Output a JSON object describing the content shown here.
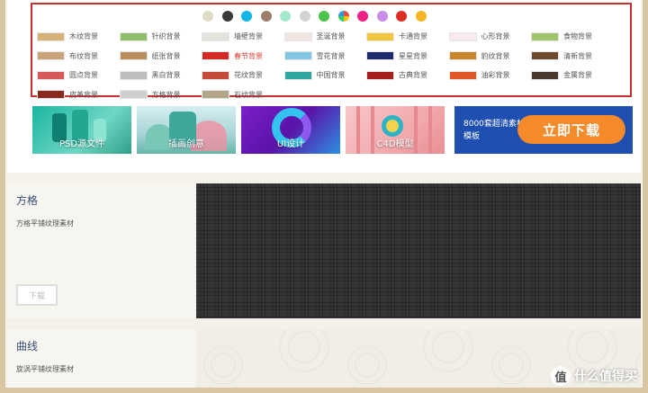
{
  "colors": {
    "swatches": [
      "#dedcc6",
      "#3a3a3a",
      "#12b6e6",
      "#9c7d6b",
      "#a4e8cc",
      "#d2d2d2",
      "#4cc34a",
      "multi",
      "#ec1f86",
      "#c98ce8",
      "#e02a25",
      "#f4b522"
    ],
    "accent": "#e2382f",
    "highlight_border": "#c8302f",
    "download_orange": "#f58a2a",
    "banner_blue": "#1f4fb0"
  },
  "categories": [
    {
      "label": "木纹背景",
      "thumb": "#d8b07a"
    },
    {
      "label": "针织背景",
      "thumb": "#8fbe6a"
    },
    {
      "label": "墙壁背景",
      "thumb": "#e4e2dc"
    },
    {
      "label": "圣诞背景",
      "thumb": "#f3e4e4"
    },
    {
      "label": "卡通背景",
      "thumb": "#f0c63a"
    },
    {
      "label": "心形背景",
      "thumb": "#f7e9ee"
    },
    {
      "label": "食物背景",
      "thumb": "#9fc46b"
    },
    {
      "label": "布纹背景",
      "thumb": "#c9a37b"
    },
    {
      "label": "纸张背景",
      "thumb": "#b98c5c"
    },
    {
      "label": "春节背景",
      "thumb": "#d42a24",
      "active": true
    },
    {
      "label": "雪花背景",
      "thumb": "#7fc7e2"
    },
    {
      "label": "星星背景",
      "thumb": "#1e2a6b"
    },
    {
      "label": "豹纹背景",
      "thumb": "#c8862d"
    },
    {
      "label": "清新背景",
      "thumb": "#6d4a2e"
    },
    {
      "label": "圆点背景",
      "thumb": "#d65a5a"
    },
    {
      "label": "黑白背景",
      "thumb": "#bdbdbd"
    },
    {
      "label": "花纹背景",
      "thumb": "#c44b3a"
    },
    {
      "label": "中国背景",
      "thumb": "#2ea6a1"
    },
    {
      "label": "古典背景",
      "thumb": "#a51f1f"
    },
    {
      "label": "油彩背景",
      "thumb": "#e0572a"
    },
    {
      "label": "金属背景",
      "thumb": "#4a3a2e"
    },
    {
      "label": "皮革背景",
      "thumb": "#8a2a1f"
    },
    {
      "label": "方格背景",
      "thumb": "#cfcfcf"
    },
    {
      "label": "石纹背景",
      "thumb": "#b3a58a"
    }
  ],
  "banners": [
    {
      "caption": "PSD源文件"
    },
    {
      "caption": "插画创意"
    },
    {
      "caption": "UI设计"
    },
    {
      "caption": "C4D模型"
    }
  ],
  "download_banner": {
    "text": "8000套超清素材模板",
    "button": "立即下载"
  },
  "sections": [
    {
      "title": "方格",
      "desc": "方格平铺纹理素材",
      "button": "下载"
    },
    {
      "title": "曲线",
      "desc": "旋涡平铺纹理素材"
    }
  ],
  "watermark": {
    "icon_text": "值",
    "text": "什么值得买"
  }
}
